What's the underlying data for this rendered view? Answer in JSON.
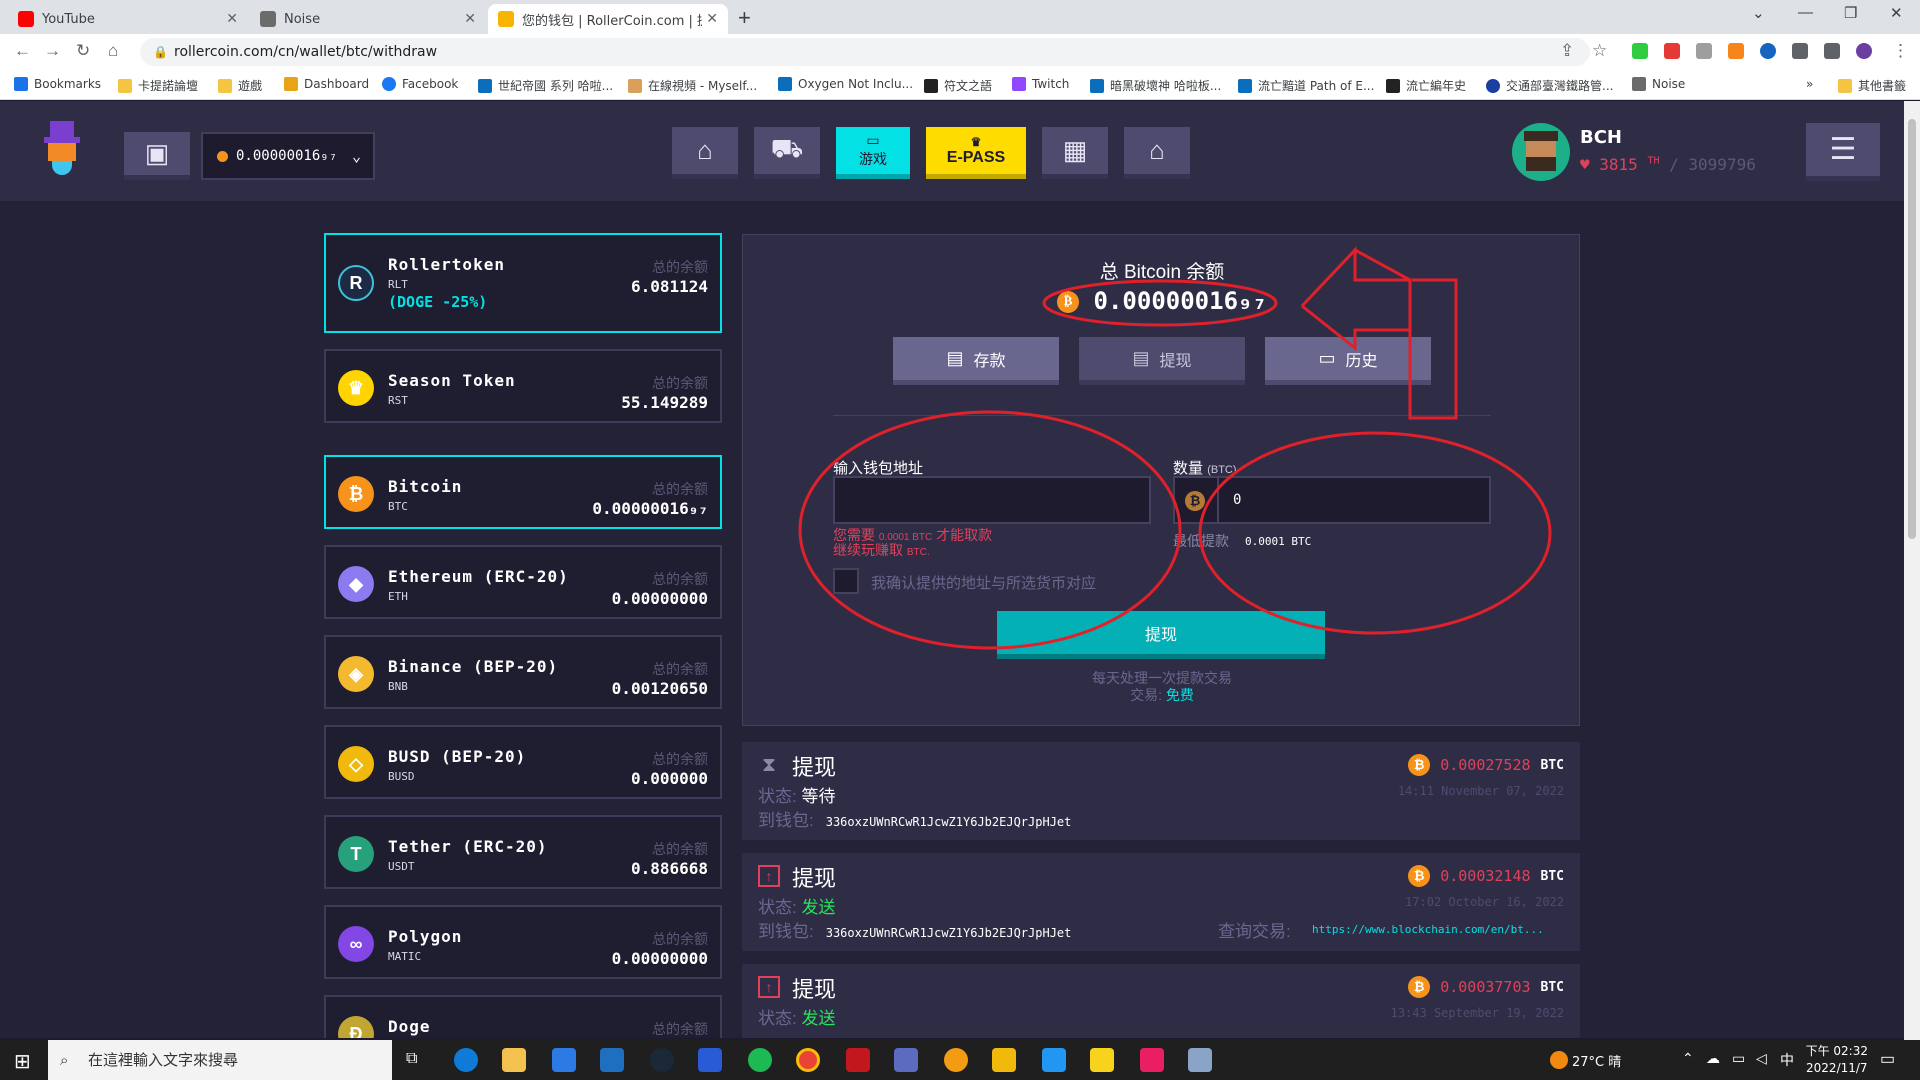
{
  "browser": {
    "tabs": [
      {
        "title": "YouTube",
        "color": "#ff0000"
      },
      {
        "title": "Noise",
        "color": "#6b6b6b"
      },
      {
        "title": "您的钱包 | RollerCoin.com | 提现",
        "color": "#f7b500"
      }
    ],
    "url": "rollercoin.com/cn/wallet/btc/withdraw",
    "bookmarks": [
      {
        "label": "Bookmarks",
        "color": "#1a73e8"
      },
      {
        "label": "卡提諾論壇",
        "color": "#f4c542"
      },
      {
        "label": "遊戲",
        "color": "#f4c542"
      },
      {
        "label": "Dashboard",
        "color": "#e8a317"
      },
      {
        "label": "Facebook",
        "color": "#1877f2"
      },
      {
        "label": "世紀帝國 系列 哈啦...",
        "color": "#0a6ebd"
      },
      {
        "label": "在線視頻 - Myself...",
        "color": "#d8a05a"
      },
      {
        "label": "Oxygen Not Inclu...",
        "color": "#0a6ebd"
      },
      {
        "label": "符文之語",
        "color": "#222222"
      },
      {
        "label": "Twitch",
        "color": "#9146ff"
      },
      {
        "label": "暗黑破壞神 哈啦板...",
        "color": "#0a6ebd"
      },
      {
        "label": "流亡黯道 Path of E...",
        "color": "#0a6ebd"
      },
      {
        "label": "流亡編年史",
        "color": "#222222"
      },
      {
        "label": "交通部臺灣鐵路管...",
        "color": "#1a3fa0"
      },
      {
        "label": "Noise",
        "color": "#6b6b6b"
      }
    ],
    "other_bookmarks": "其他書籤"
  },
  "header": {
    "wallet_balance": "0.00000016₉₇",
    "nav": [
      {
        "icon": "home-icon",
        "glyph": "⌂"
      },
      {
        "icon": "marketplace-icon",
        "glyph": "🛒"
      },
      {
        "icon": "game-icon",
        "label": "游戏"
      },
      {
        "icon": "epass-icon",
        "label": "E-PASS"
      },
      {
        "icon": "storage-icon",
        "glyph": "▦"
      },
      {
        "icon": "warehouse-icon",
        "glyph": "⌂"
      }
    ],
    "user_name": "BCH",
    "user_power": "3815",
    "user_power_unit": "TH",
    "user_max": "/ 3099796"
  },
  "currencies": [
    {
      "name": "Rollertoken",
      "code": "RLT",
      "balance_label": "总的余额",
      "balance": "6.081124",
      "promo": "(DOGE -25%)",
      "color": "#1d2a45",
      "glyph": "R",
      "active": true
    },
    {
      "name": "Season Token",
      "code": "RST",
      "balance_label": "总的余额",
      "balance": "55.149289",
      "color": "#ffd400",
      "glyph": "♛"
    },
    {
      "name": "Bitcoin",
      "code": "BTC",
      "balance_label": "总的余额",
      "balance": "0.00000016₉₇",
      "color": "#f7931a",
      "glyph": "₿",
      "selected": true
    },
    {
      "name": "Ethereum (ERC-20)",
      "code": "ETH",
      "balance_label": "总的余额",
      "balance": "0.00000000",
      "color": "#8a7bf0",
      "glyph": "◆"
    },
    {
      "name": "Binance (BEP-20)",
      "code": "BNB",
      "balance_label": "总的余额",
      "balance": "0.00120650",
      "color": "#f3ba2f",
      "glyph": "◈"
    },
    {
      "name": "BUSD (BEP-20)",
      "code": "BUSD",
      "balance_label": "总的余额",
      "balance": "0.000000",
      "color": "#f0b90b",
      "glyph": "◇"
    },
    {
      "name": "Tether (ERC-20)",
      "code": "USDT",
      "balance_label": "总的余额",
      "balance": "0.886668",
      "color": "#26a17b",
      "glyph": "T"
    },
    {
      "name": "Polygon",
      "code": "MATIC",
      "balance_label": "总的余额",
      "balance": "0.00000000",
      "color": "#8247e5",
      "glyph": "∞"
    },
    {
      "name": "Doge",
      "code": "",
      "balance_label": "总的余额",
      "balance": "",
      "color": "#c2a633",
      "glyph": "Ð"
    }
  ],
  "panel": {
    "title": "总 Bitcoin 余额",
    "balance": "0.00000016₉₇",
    "deposit_label": "存款",
    "withdraw_label": "提现",
    "history_label": "历史",
    "address_label": "输入钱包地址",
    "amount_label": "数量",
    "amount_unit": "(BTC)",
    "amount_value": "0",
    "error_line1_a": "您需要",
    "error_line1_b": "0.0001 BTC",
    "error_line1_c": "才能取款",
    "error_line2_a": "继续玩赚取",
    "error_line2_b": "BTC.",
    "min_label": "最低提款",
    "min_value": "0.0001 BTC",
    "confirm_label": "我确认提供的地址与所选货币对应",
    "submit_label": "提现",
    "note1": "每天处理一次提款交易",
    "note2_a": "交易:",
    "note2_b": "免费"
  },
  "history": [
    {
      "title": "提现",
      "status_label": "状态:",
      "status": "等待",
      "status_color": "white",
      "wallet_label": "到钱包:",
      "wallet": "336oxzUWnRCwR1JcwZ1Y6Jb2EJQrJpHJet",
      "amount": "0.00027528",
      "unit": "BTC",
      "date": "14:11 November 07, 2022",
      "icon": "hourglass-icon"
    },
    {
      "title": "提现",
      "status_label": "状态:",
      "status": "发送",
      "status_color": "green",
      "wallet_label": "到钱包:",
      "wallet": "336oxzUWnRCwR1JcwZ1Y6Jb2EJQrJpHJet",
      "amount": "0.00032148",
      "unit": "BTC",
      "date": "17:02 October 16, 2022",
      "tx_label": "查询交易:",
      "tx": "https://www.blockchain.com/en/bt...",
      "icon": "upload-arrow-icon"
    },
    {
      "title": "提现",
      "status_label": "状态:",
      "status": "发送",
      "status_color": "green",
      "wallet_label": "到钱包:",
      "wallet": "",
      "amount": "0.00037703",
      "unit": "BTC",
      "date": "13:43 September 19, 2022",
      "icon": "upload-arrow-icon"
    }
  ],
  "taskbar": {
    "search_placeholder": "在這裡輸入文字來搜尋",
    "weather": "27°C 晴",
    "time": "下午 02:32",
    "date": "2022/11/7",
    "ime": "中"
  }
}
